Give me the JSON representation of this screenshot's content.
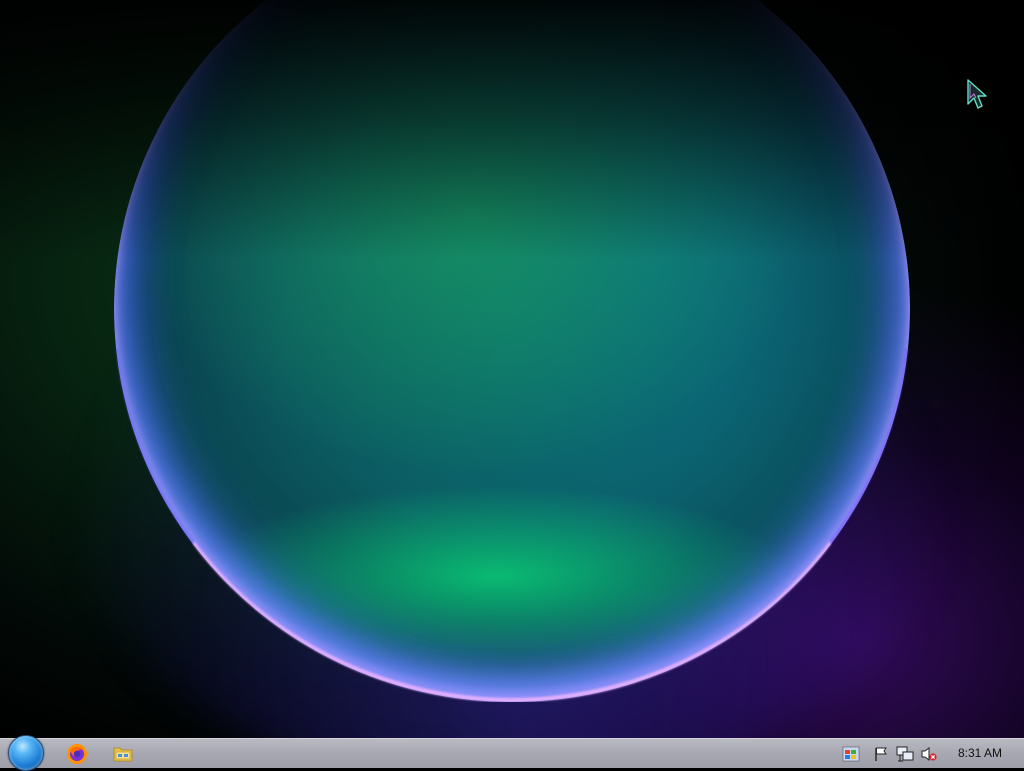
{
  "taskbar": {
    "start_button_icon": "start-orb-icon",
    "pinned": [
      {
        "name": "firefox",
        "icon": "firefox-icon"
      },
      {
        "name": "file-explorer",
        "icon": "folder-icon"
      }
    ],
    "tray": {
      "icons": [
        "windows-flag-icon",
        "action-center-flag-icon",
        "network-icon",
        "volume-muted-icon"
      ],
      "clock": "8:31 AM"
    }
  },
  "colors": {
    "taskbar_bg": "#a8a8b2",
    "start_orb": "#1e7fd6",
    "wallpaper_green": "#0c6d5e",
    "wallpaper_purple": "#5a14a0"
  }
}
